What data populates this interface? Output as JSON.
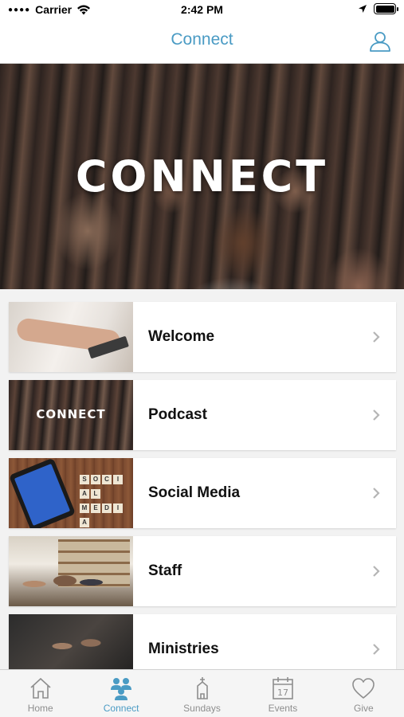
{
  "status_bar": {
    "carrier": "Carrier",
    "time": "2:42 PM"
  },
  "nav": {
    "title": "Connect",
    "profile_icon": "person-icon"
  },
  "hero": {
    "title": "CONNECT"
  },
  "menu": {
    "items": [
      {
        "label": "Welcome",
        "thumb": "welcome"
      },
      {
        "label": "Podcast",
        "thumb": "podcast",
        "thumb_text": "CONNECT"
      },
      {
        "label": "Social Media",
        "thumb": "social",
        "thumb_tiles": [
          "S",
          "O",
          "C",
          "I",
          "A",
          "L",
          "M",
          "E",
          "D",
          "I",
          "A"
        ]
      },
      {
        "label": "Staff",
        "thumb": "staff"
      },
      {
        "label": "Ministries",
        "thumb": "ministries"
      }
    ]
  },
  "tabs": [
    {
      "label": "Home",
      "icon": "home-icon",
      "active": false
    },
    {
      "label": "Connect",
      "icon": "people-icon",
      "active": true
    },
    {
      "label": "Sundays",
      "icon": "church-icon",
      "active": false
    },
    {
      "label": "Events",
      "icon": "calendar-icon",
      "active": false,
      "icon_text": "17"
    },
    {
      "label": "Give",
      "icon": "heart-icon",
      "active": false
    }
  ],
  "colors": {
    "accent": "#4a9bc4",
    "tab_inactive": "#8e8e8e",
    "background": "#f2f2f2"
  }
}
